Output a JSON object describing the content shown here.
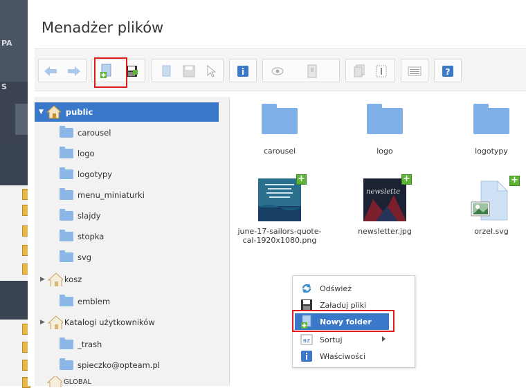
{
  "dialog": {
    "title": "Menadżer plików"
  },
  "sidebar_strip": {
    "labels": [
      "PA",
      "S"
    ]
  },
  "tree": {
    "root": "public",
    "folders": [
      "carousel",
      "logo",
      "logotypy",
      "menu_miniaturki",
      "slajdy",
      "stopka",
      "svg"
    ],
    "kosz": "kosz",
    "kosz_children": [
      "emblem"
    ],
    "katalogi": "Katalogi użytkowników",
    "katalogi_children": [
      "_trash",
      "spieczko@opteam.pl"
    ],
    "global": "GLOBAL"
  },
  "files": [
    {
      "name": "carousel",
      "type": "folder"
    },
    {
      "name": "logo",
      "type": "folder"
    },
    {
      "name": "logotypy",
      "type": "folder"
    },
    {
      "name": "june-17-sailors-quote-cal-1920x1080.png",
      "type": "image"
    },
    {
      "name": "newsletter.jpg",
      "type": "image",
      "thumb_text": "newslette"
    },
    {
      "name": "orzel.svg",
      "type": "svg"
    }
  ],
  "context_menu": {
    "items": [
      {
        "label": "Odśwież",
        "icon": "refresh-icon"
      },
      {
        "label": "Załaduj pliki",
        "icon": "upload-icon"
      },
      {
        "label": "Nowy folder",
        "icon": "new-folder-icon"
      },
      {
        "label": "Sortuj",
        "icon": "sort-icon"
      },
      {
        "label": "Właściwości",
        "icon": "info-icon"
      }
    ]
  },
  "colors": {
    "selection": "#3a78c9",
    "highlight": "#e01b1b",
    "folder": "#7fb0e8"
  }
}
